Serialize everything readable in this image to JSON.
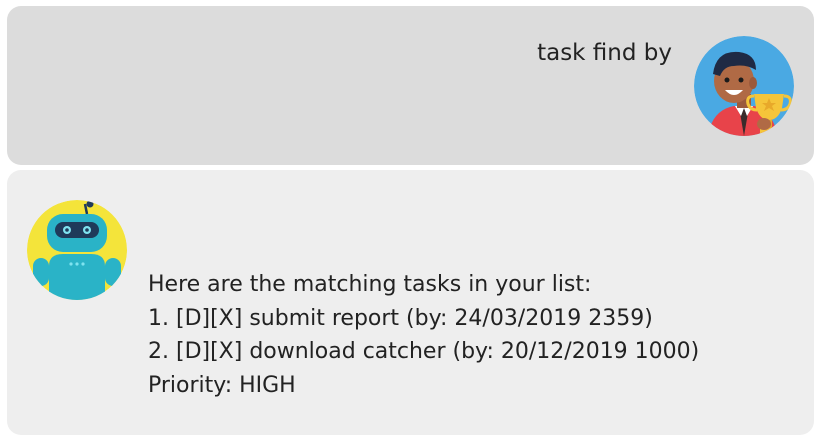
{
  "user_message": {
    "text": "task find by",
    "avatar_icon": "user-with-trophy-icon"
  },
  "bot_message": {
    "avatar_icon": "robot-icon",
    "lines": [
      "Here are the matching tasks in your list:",
      "1. [D][X] submit report (by: 24/03/2019 2359)",
      "2. [D][X] download catcher (by: 20/12/2019 1000)",
      "Priority: HIGH"
    ]
  },
  "colors": {
    "user_bubble": "#dcdcdc",
    "bot_bubble": "#eeeeee",
    "user_avatar_bg": "#4aa9e3",
    "bot_avatar_bg": "#f4e43a",
    "robot_body": "#2ab3c7"
  }
}
